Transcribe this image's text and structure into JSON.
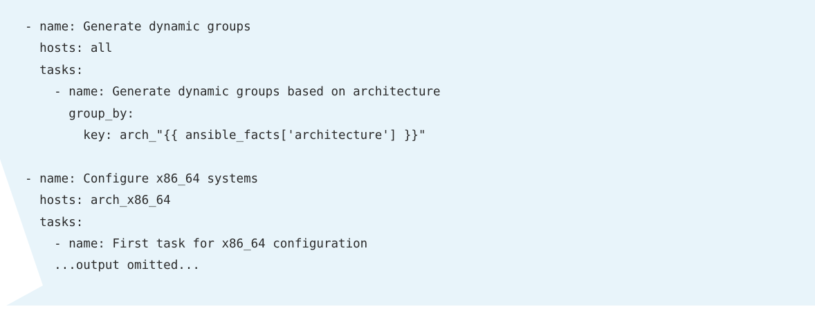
{
  "code": {
    "lines": [
      "- name: Generate dynamic groups",
      "  hosts: all",
      "  tasks:",
      "    - name: Generate dynamic groups based on architecture",
      "      group_by:",
      "        key: arch_\"{{ ansible_facts['architecture'] }}\"",
      "",
      "- name: Configure x86_64 systems",
      "  hosts: arch_x86_64",
      "  tasks:",
      "    - name: First task for x86_64 configuration",
      "    ...output omitted..."
    ]
  },
  "colors": {
    "background": "#e8f4fa",
    "text": "#2a2a2a"
  }
}
